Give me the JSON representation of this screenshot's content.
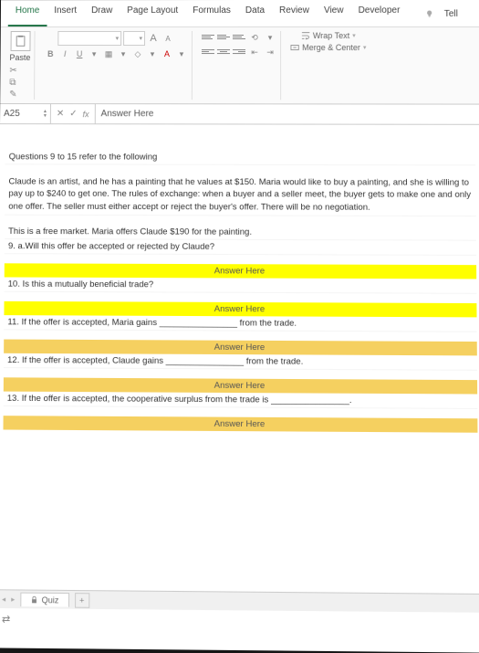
{
  "tabs": [
    "Home",
    "Insert",
    "Draw",
    "Page Layout",
    "Formulas",
    "Data",
    "Review",
    "View",
    "Developer"
  ],
  "tell": "Tell",
  "paste": "Paste",
  "fontButtons": {
    "bold": "B",
    "italic": "I",
    "underline": "U"
  },
  "fontSizeA1": "A",
  "fontSizeA2": "A",
  "wrapText": "Wrap Text",
  "mergeCenter": "Merge & Center",
  "nameBox": "A25",
  "fx": "fx",
  "formulaValue": "Answer Here",
  "content": {
    "intro": "Questions 9 to 15 refer to the following",
    "scenario": "Claude is an artist, and he has a painting that he values at $150. Maria would like to buy a painting, and she is willing to pay up to $240 to get one. The rules of exchange: when a buyer and a seller meet, the buyer gets to make one and only one offer. The seller must either accept or reject the buyer's offer. There will be no negotiation.",
    "premise": "This is a free market. Maria offers Claude $190 for the painting.",
    "q9": "9. a.Will this offer be accepted or rejected by Claude?",
    "q10": "10. Is this a mutually beneficial trade?",
    "q11": "11. If the offer is accepted, Maria gains ________________ from the trade.",
    "q12": "12. If the offer is accepted, Claude  gains ________________ from the trade.",
    "q13": "13. If the offer is accepted, the cooperative surplus from the trade is ________________.",
    "answer": "Answer Here"
  },
  "sheetTab": "Quiz",
  "statusIcon": "⇄"
}
